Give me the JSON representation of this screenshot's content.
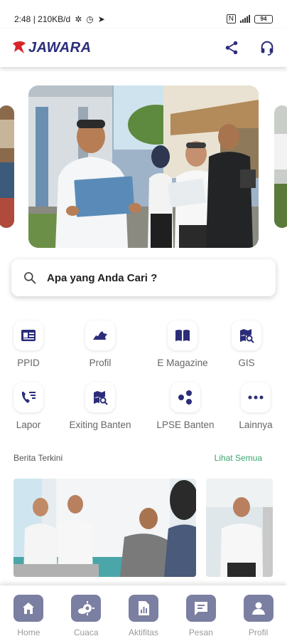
{
  "status": {
    "time_speed": "2:48 | 210KB/d",
    "battery": "94"
  },
  "header": {
    "logo_text": "JAWARA",
    "share_icon": "share-icon",
    "support_icon": "headset-icon"
  },
  "search": {
    "placeholder": "Apa yang Anda Cari ?"
  },
  "menu": {
    "items": [
      {
        "label": "PPID",
        "icon": "id-card-icon"
      },
      {
        "label": "Profil",
        "icon": "map-profile-icon"
      },
      {
        "label": "E Magazine",
        "icon": "book-icon"
      },
      {
        "label": "GIS",
        "icon": "map-search-icon"
      },
      {
        "label": "Lapor",
        "icon": "phone-list-icon"
      },
      {
        "label": "Exiting Banten",
        "icon": "map-search-icon"
      },
      {
        "label": "LPSE Banten",
        "icon": "network-icon"
      },
      {
        "label": "Lainnya",
        "icon": "more-icon"
      }
    ]
  },
  "news": {
    "title": "Berita Terkini",
    "see_all": "Lihat Semua"
  },
  "nav": {
    "items": [
      {
        "label": "Home",
        "icon": "home-icon"
      },
      {
        "label": "Cuaca",
        "icon": "weather-icon"
      },
      {
        "label": "Aktifitas",
        "icon": "activity-icon"
      },
      {
        "label": "Pesan",
        "icon": "message-icon"
      },
      {
        "label": "Profil",
        "icon": "user-icon"
      }
    ]
  },
  "colors": {
    "brand": "#2b2d7a",
    "accent_red": "#d7262b",
    "link_green": "#3aa76d",
    "nav_icon_bg": "#7b7fa1"
  }
}
